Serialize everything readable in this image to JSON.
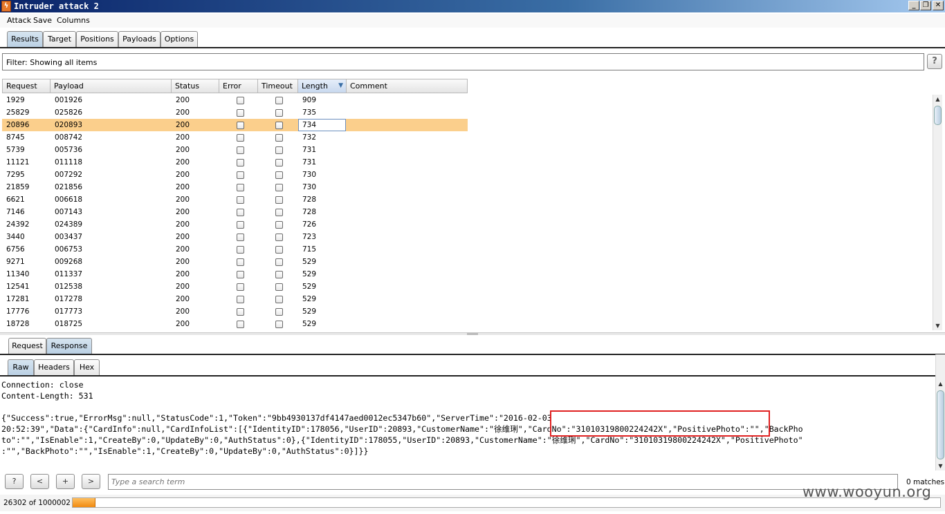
{
  "window": {
    "title": "Intruder attack 2",
    "icon": "burp-lightning-icon"
  },
  "menu": [
    "Attack",
    "Save",
    "Columns"
  ],
  "main_tabs": [
    "Results",
    "Target",
    "Positions",
    "Payloads",
    "Options"
  ],
  "filter": {
    "text": "Filter:  Showing all items",
    "help": "?"
  },
  "table": {
    "columns": [
      "Request",
      "Payload",
      "Status",
      "Error",
      "Timeout",
      "Length",
      "Comment"
    ],
    "sorted_column": "Length",
    "selected_row_index": 2,
    "rows": [
      {
        "request": "1929",
        "payload": "001926",
        "status": "200",
        "error": false,
        "timeout": false,
        "length": "909"
      },
      {
        "request": "25829",
        "payload": "025826",
        "status": "200",
        "error": false,
        "timeout": false,
        "length": "735"
      },
      {
        "request": "20896",
        "payload": "020893",
        "status": "200",
        "error": false,
        "timeout": false,
        "length": "734"
      },
      {
        "request": "8745",
        "payload": "008742",
        "status": "200",
        "error": false,
        "timeout": false,
        "length": "732"
      },
      {
        "request": "5739",
        "payload": "005736",
        "status": "200",
        "error": false,
        "timeout": false,
        "length": "731"
      },
      {
        "request": "11121",
        "payload": "011118",
        "status": "200",
        "error": false,
        "timeout": false,
        "length": "731"
      },
      {
        "request": "7295",
        "payload": "007292",
        "status": "200",
        "error": false,
        "timeout": false,
        "length": "730"
      },
      {
        "request": "21859",
        "payload": "021856",
        "status": "200",
        "error": false,
        "timeout": false,
        "length": "730"
      },
      {
        "request": "6621",
        "payload": "006618",
        "status": "200",
        "error": false,
        "timeout": false,
        "length": "728"
      },
      {
        "request": "7146",
        "payload": "007143",
        "status": "200",
        "error": false,
        "timeout": false,
        "length": "728"
      },
      {
        "request": "24392",
        "payload": "024389",
        "status": "200",
        "error": false,
        "timeout": false,
        "length": "726"
      },
      {
        "request": "3440",
        "payload": "003437",
        "status": "200",
        "error": false,
        "timeout": false,
        "length": "723"
      },
      {
        "request": "6756",
        "payload": "006753",
        "status": "200",
        "error": false,
        "timeout": false,
        "length": "715"
      },
      {
        "request": "9271",
        "payload": "009268",
        "status": "200",
        "error": false,
        "timeout": false,
        "length": "529"
      },
      {
        "request": "11340",
        "payload": "011337",
        "status": "200",
        "error": false,
        "timeout": false,
        "length": "529"
      },
      {
        "request": "12541",
        "payload": "012538",
        "status": "200",
        "error": false,
        "timeout": false,
        "length": "529"
      },
      {
        "request": "17281",
        "payload": "017278",
        "status": "200",
        "error": false,
        "timeout": false,
        "length": "529"
      },
      {
        "request": "17776",
        "payload": "017773",
        "status": "200",
        "error": false,
        "timeout": false,
        "length": "529"
      },
      {
        "request": "18728",
        "payload": "018725",
        "status": "200",
        "error": false,
        "timeout": false,
        "length": "529"
      }
    ]
  },
  "detail_tabs": [
    "Request",
    "Response"
  ],
  "detail_active": "Response",
  "view_tabs": [
    "Raw",
    "Headers",
    "Hex"
  ],
  "view_active": "Raw",
  "response": {
    "lines": [
      "Connection: close",
      "Content-Length: 531",
      "",
      "{\"Success\":true,\"ErrorMsg\":null,\"StatusCode\":1,\"Token\":\"9bb4930137df4147aed0012ec5347b60\",\"ServerTime\":\"2016-02-03",
      "20:52:39\",\"Data\":{\"CardInfo\":null,\"CardInfoList\":[{\"IdentityID\":178056,\"UserID\":20893,\"CustomerName\":\"徐维琍\",\"CardNo\":\"31010319800224242X\",\"PositivePhoto\":\"\",\"BackPho",
      "to\":\"\",\"IsEnable\":1,\"CreateBy\":0,\"UpdateBy\":0,\"AuthStatus\":0},{\"IdentityID\":178055,\"UserID\":20893,\"CustomerName\":\"徐维琍\",\"CardNo\":\"31010319800224242X\",\"PositivePhoto\"",
      ":\"\",\"BackPhoto\":\"\",\"IsEnable\":1,\"CreateBy\":0,\"UpdateBy\":0,\"AuthStatus\":0}]}}"
    ]
  },
  "search": {
    "placeholder": "Type a search term",
    "matches": "0 matches",
    "buttons": [
      "?",
      "<",
      "+",
      ">"
    ]
  },
  "progress": {
    "text": "26302 of 1000002",
    "fraction": 0.0263
  },
  "watermark": "www.wooyun.org",
  "colors": {
    "selected_row": "#fbcf8c",
    "highlight_box": "#e02020",
    "title_gradient_start": "#0a246a"
  }
}
